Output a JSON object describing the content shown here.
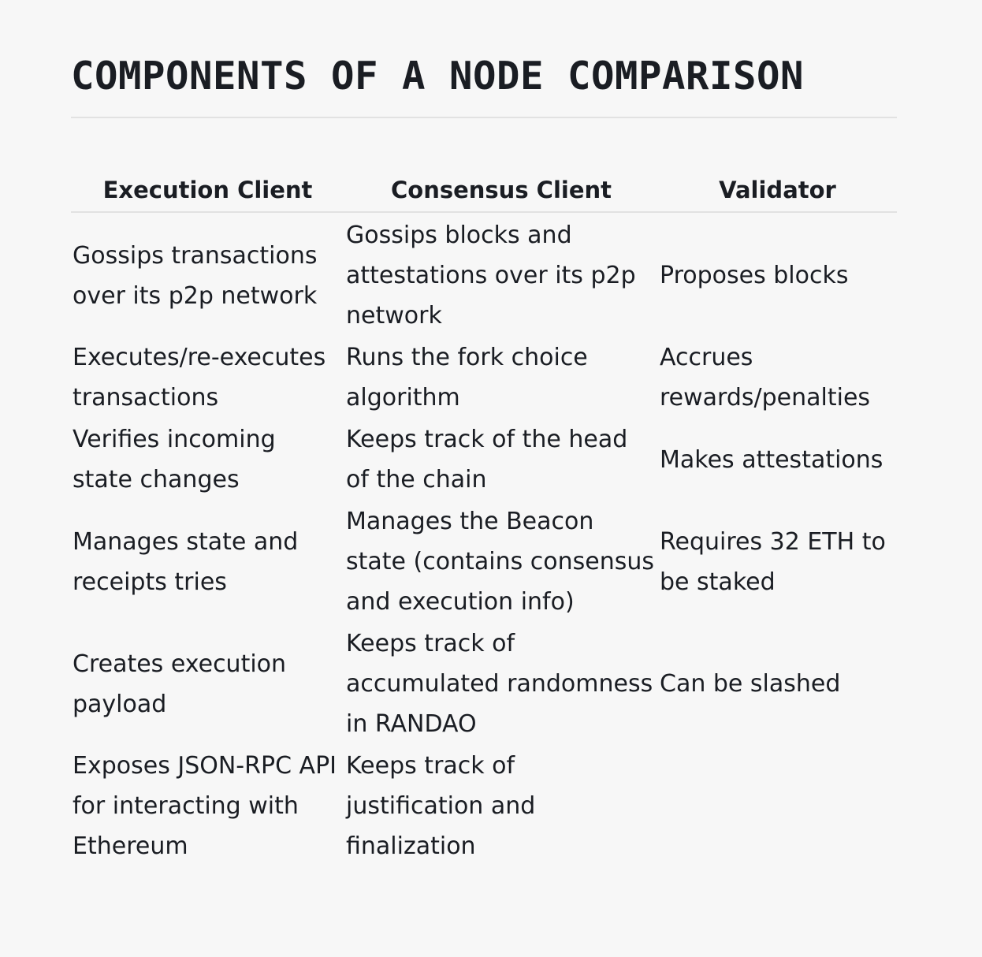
{
  "title": "COMPONENTS OF A NODE COMPARISON",
  "table": {
    "headers": [
      "Execution Client",
      "Consensus Client",
      "Validator"
    ],
    "rows": [
      [
        "Gossips transactions over its p2p network",
        "Gossips blocks and attestations over its p2p network",
        "Proposes blocks"
      ],
      [
        "Executes/re-executes transactions",
        "Runs the fork choice algorithm",
        "Accrues rewards/penalties"
      ],
      [
        "Verifies incoming state changes",
        "Keeps track of the head of the chain",
        "Makes attestations"
      ],
      [
        "Manages state and receipts tries",
        "Manages the Beacon state (contains consensus and execution info)",
        "Requires 32 ETH to be staked"
      ],
      [
        "Creates execution payload",
        "Keeps track of accumulated randomness in RANDAO",
        "Can be slashed"
      ],
      [
        "Exposes JSON-RPC API for interacting with Ethereum",
        "Keeps track of justification and finalization",
        ""
      ]
    ]
  }
}
